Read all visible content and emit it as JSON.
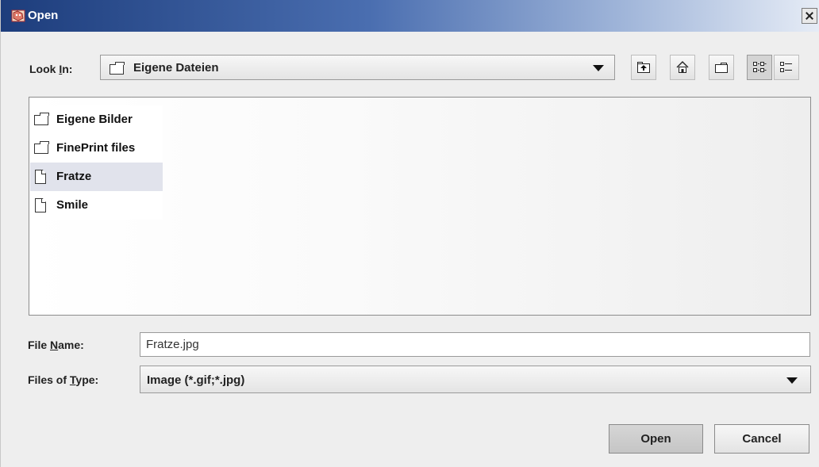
{
  "window": {
    "title": "Open"
  },
  "look_in": {
    "label_pre": "Look ",
    "label_mnemonic": "I",
    "label_post": "n:",
    "value": "Eigene Dateien"
  },
  "toolbar": [
    {
      "name": "up-folder-button",
      "icon": "up-one-level-icon"
    },
    {
      "name": "home-button",
      "icon": "home-icon"
    },
    {
      "name": "new-folder-button",
      "icon": "new-folder-icon"
    },
    {
      "name": "list-view-button",
      "icon": "list-view-icon",
      "active": true
    },
    {
      "name": "details-view-button",
      "icon": "details-view-icon",
      "active": false
    }
  ],
  "files": [
    {
      "name": "Eigene Bilder",
      "type": "folder",
      "selected": false
    },
    {
      "name": "FinePrint files",
      "type": "folder",
      "selected": false
    },
    {
      "name": "Fratze",
      "type": "file",
      "selected": true
    },
    {
      "name": "Smile",
      "type": "file",
      "selected": false
    }
  ],
  "file_name": {
    "label_pre": "File ",
    "label_mnemonic": "N",
    "label_post": "ame:",
    "value": "Fratze.jpg"
  },
  "file_type": {
    "label_pre": "Files of ",
    "label_mnemonic": "T",
    "label_post": "ype:",
    "value": "Image (*.gif;*.jpg)"
  },
  "buttons": {
    "open": "Open",
    "cancel": "Cancel"
  },
  "colors": {
    "title_start": "#1d3d7c",
    "selection": "#e1e3ec"
  }
}
